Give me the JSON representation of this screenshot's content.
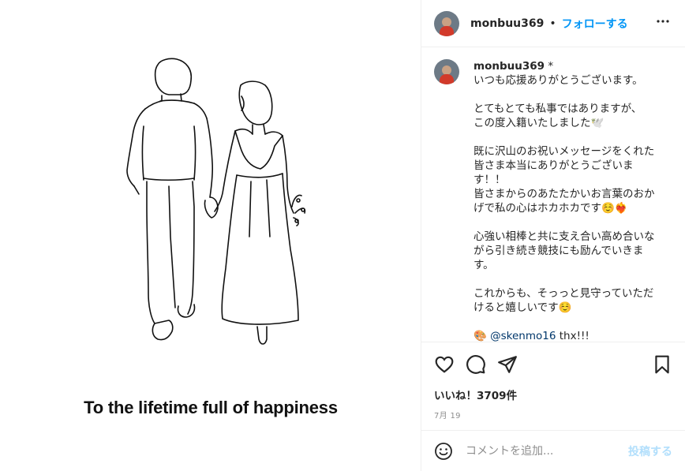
{
  "media": {
    "overlay_text": "To the lifetime full of happiness"
  },
  "header": {
    "username": "monbuu369",
    "separator": "•",
    "follow_label": "フォローする",
    "more_icon": "more-horizontal-icon"
  },
  "caption": {
    "username": "monbuu369",
    "lines": [
      "いつも応援ありがとうございます。",
      "",
      "とてもとても私事ではありますが、",
      "この度入籍いたしました🕊️",
      "",
      "既に沢山のお祝いメッセージをくれた",
      "皆さま本当にありがとうございま",
      "す！！",
      "皆さまからのあたたかいお言葉のおか",
      "げで私の心はホカホカです☺️❤️‍🔥",
      "",
      "心強い相棒と共に支え合い高め合いな",
      "がら引き続き競技にも励んでいきま",
      "す。",
      "",
      "これからも、そっっと見守っていただ",
      "けると嬉しいです☺️",
      ""
    ],
    "mention_prefix": "🎨 ",
    "mention": "@skenmo16",
    "mention_suffix": " thx!!!"
  },
  "actions": {
    "likes": "いいね！3709件",
    "date": "7月 19"
  },
  "comment_box": {
    "placeholder": "コメントを追加...",
    "post_label": "投稿する"
  },
  "colors": {
    "accent": "#0095f6",
    "post_disabled": "#b2dffc",
    "mention": "#00376b"
  }
}
